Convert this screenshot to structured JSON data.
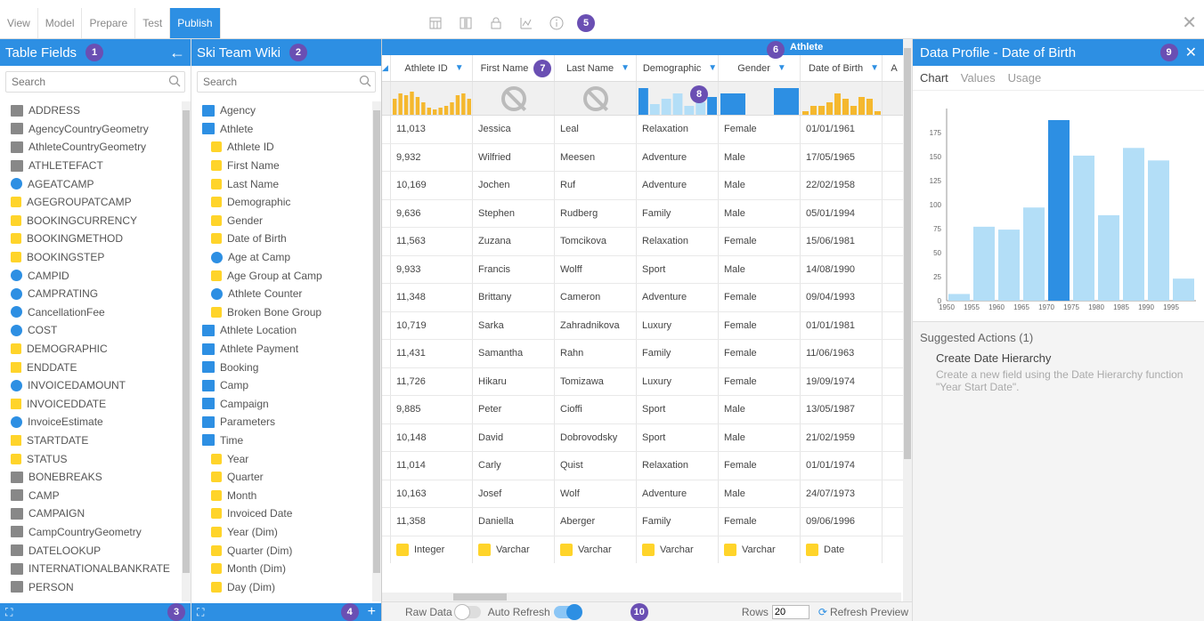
{
  "tabs": [
    "View",
    "Model",
    "Prepare",
    "Test",
    "Publish"
  ],
  "active_tab": "Publish",
  "badges": [
    "1",
    "2",
    "3",
    "4",
    "5",
    "6",
    "7",
    "8",
    "9",
    "10"
  ],
  "table_fields": {
    "title": "Table Fields",
    "search_placeholder": "Search",
    "items": [
      {
        "label": "ADDRESS",
        "icon": "folder"
      },
      {
        "label": "AgencyCountryGeometry",
        "icon": "folder"
      },
      {
        "label": "AthleteCountryGeometry",
        "icon": "folder"
      },
      {
        "label": "ATHLETEFACT",
        "icon": "folder-open"
      },
      {
        "label": "AGEATCAMP",
        "icon": "blue"
      },
      {
        "label": "AGEGROUPATCAMP",
        "icon": "yellow"
      },
      {
        "label": "BOOKINGCURRENCY",
        "icon": "yellow"
      },
      {
        "label": "BOOKINGMETHOD",
        "icon": "yellow"
      },
      {
        "label": "BOOKINGSTEP",
        "icon": "yellow"
      },
      {
        "label": "CAMPID",
        "icon": "blue"
      },
      {
        "label": "CAMPRATING",
        "icon": "blue"
      },
      {
        "label": "CancellationFee",
        "icon": "blue"
      },
      {
        "label": "COST",
        "icon": "blue"
      },
      {
        "label": "DEMOGRAPHIC",
        "icon": "yellow"
      },
      {
        "label": "ENDDATE",
        "icon": "cal"
      },
      {
        "label": "INVOICEDAMOUNT",
        "icon": "blue"
      },
      {
        "label": "INVOICEDDATE",
        "icon": "cal"
      },
      {
        "label": "InvoiceEstimate",
        "icon": "blue"
      },
      {
        "label": "STARTDATE",
        "icon": "cal"
      },
      {
        "label": "STATUS",
        "icon": "yellow"
      },
      {
        "label": "BONEBREAKS",
        "icon": "folder"
      },
      {
        "label": "CAMP",
        "icon": "folder"
      },
      {
        "label": "CAMPAIGN",
        "icon": "folder"
      },
      {
        "label": "CampCountryGeometry",
        "icon": "folder"
      },
      {
        "label": "DATELOOKUP",
        "icon": "folder"
      },
      {
        "label": "INTERNATIONALBANKRATE",
        "icon": "folder"
      },
      {
        "label": "PERSON",
        "icon": "folder"
      }
    ]
  },
  "ski_wiki": {
    "title": "Ski Team Wiki",
    "search_placeholder": "Search",
    "items": [
      {
        "label": "Agency",
        "icon": "folderb",
        "level": 0
      },
      {
        "label": "Athlete",
        "icon": "folderb",
        "level": 0
      },
      {
        "label": "Athlete ID",
        "icon": "yellow",
        "level": 1
      },
      {
        "label": "First Name",
        "icon": "yellow",
        "level": 1
      },
      {
        "label": "Last Name",
        "icon": "yellow",
        "level": 1
      },
      {
        "label": "Demographic",
        "icon": "yellow",
        "level": 1
      },
      {
        "label": "Gender",
        "icon": "yellow",
        "level": 1
      },
      {
        "label": "Date of Birth",
        "icon": "yellow",
        "level": 1
      },
      {
        "label": "Age at Camp",
        "icon": "blue",
        "level": 1
      },
      {
        "label": "Age Group at Camp",
        "icon": "yellow",
        "level": 1
      },
      {
        "label": "Athlete Counter",
        "icon": "blue",
        "level": 1
      },
      {
        "label": "Broken Bone Group",
        "icon": "yellow",
        "level": 1
      },
      {
        "label": "Athlete Location",
        "icon": "folderb",
        "level": 0
      },
      {
        "label": "Athlete Payment",
        "icon": "folderb",
        "level": 0
      },
      {
        "label": "Booking",
        "icon": "folderb",
        "level": 0
      },
      {
        "label": "Camp",
        "icon": "folderb",
        "level": 0
      },
      {
        "label": "Campaign",
        "icon": "folderb",
        "level": 0
      },
      {
        "label": "Parameters",
        "icon": "folderb",
        "level": 0
      },
      {
        "label": "Time",
        "icon": "folderb",
        "level": 0
      },
      {
        "label": "Year",
        "icon": "yellow",
        "level": 1
      },
      {
        "label": "Quarter",
        "icon": "yellow",
        "level": 1
      },
      {
        "label": "Month",
        "icon": "yellow",
        "level": 1
      },
      {
        "label": "Invoiced Date",
        "icon": "yellow",
        "level": 1
      },
      {
        "label": "Year (Dim)",
        "icon": "yellow",
        "level": 1
      },
      {
        "label": "Quarter (Dim)",
        "icon": "yellow",
        "level": 1
      },
      {
        "label": "Month (Dim)",
        "icon": "yellow",
        "level": 1
      },
      {
        "label": "Day (Dim)",
        "icon": "yellow",
        "level": 1
      }
    ]
  },
  "grid": {
    "group_title": "Athlete",
    "columns": [
      "Athlete ID",
      "First Name",
      "Last Name",
      "Demographic",
      "Gender",
      "Date of Birth",
      "A"
    ],
    "rows": [
      [
        "11,013",
        "Jessica",
        "Leal",
        "Relaxation",
        "Female",
        "01/01/1961"
      ],
      [
        "9,932",
        "Wilfried",
        "Meesen",
        "Adventure",
        "Male",
        "17/05/1965"
      ],
      [
        "10,169",
        "Jochen",
        "Ruf",
        "Adventure",
        "Male",
        "22/02/1958"
      ],
      [
        "9,636",
        "Stephen",
        "Rudberg",
        "Family",
        "Male",
        "05/01/1994"
      ],
      [
        "11,563",
        "Zuzana",
        "Tomcikova",
        "Relaxation",
        "Female",
        "15/06/1981"
      ],
      [
        "9,933",
        "Francis",
        "Wolff",
        "Sport",
        "Male",
        "14/08/1990"
      ],
      [
        "11,348",
        "Brittany",
        "Cameron",
        "Adventure",
        "Female",
        "09/04/1993"
      ],
      [
        "10,719",
        "Sarka",
        "Zahradnikova",
        "Luxury",
        "Female",
        "01/01/1981"
      ],
      [
        "11,431",
        "Samantha",
        "Rahn",
        "Family",
        "Female",
        "11/06/1963"
      ],
      [
        "11,726",
        "Hikaru",
        "Tomizawa",
        "Luxury",
        "Female",
        "19/09/1974"
      ],
      [
        "9,885",
        "Peter",
        "Cioffi",
        "Sport",
        "Male",
        "13/05/1987"
      ],
      [
        "10,148",
        "David",
        "Dobrovodsky",
        "Sport",
        "Male",
        "21/02/1959"
      ],
      [
        "11,014",
        "Carly",
        "Quist",
        "Relaxation",
        "Female",
        "01/01/1974"
      ],
      [
        "10,163",
        "Josef",
        "Wolf",
        "Adventure",
        "Male",
        "24/07/1973"
      ],
      [
        "11,358",
        "Daniella",
        "Aberger",
        "Family",
        "Female",
        "09/06/1996"
      ]
    ],
    "types": [
      "Integer",
      "Varchar",
      "Varchar",
      "Varchar",
      "Varchar",
      "Date"
    ],
    "raw_data_label": "Raw Data",
    "auto_refresh_label": "Auto Refresh",
    "rows_label": "Rows",
    "rows_value": "20",
    "refresh_label": "Refresh Preview"
  },
  "data_profile": {
    "title": "Data Profile - Date of Birth",
    "tabs": [
      "Chart",
      "Values",
      "Usage"
    ],
    "suggested_title": "Suggested Actions (1)",
    "action_title": "Create Date Hierarchy",
    "action_desc": "Create a new field using the Date Hierarchy function \"Year Start Date\"."
  },
  "chart_data": {
    "type": "bar",
    "categories": [
      "1950",
      "1955",
      "1960",
      "1965",
      "1970",
      "1975",
      "1980",
      "1985",
      "1990",
      "1995"
    ],
    "values": [
      7,
      77,
      74,
      97,
      188,
      151,
      89,
      159,
      146,
      23
    ],
    "highlight_index": 4,
    "yticks": [
      0,
      25,
      50,
      75,
      100,
      125,
      150,
      175
    ],
    "ylim": [
      0,
      200
    ],
    "colors": {
      "bar": "#b3def7",
      "highlight": "#2d8fe3"
    }
  },
  "colors": {
    "accent": "#2d8fe3",
    "badge": "#6a4fb3",
    "yellow": "#ffd42a"
  }
}
